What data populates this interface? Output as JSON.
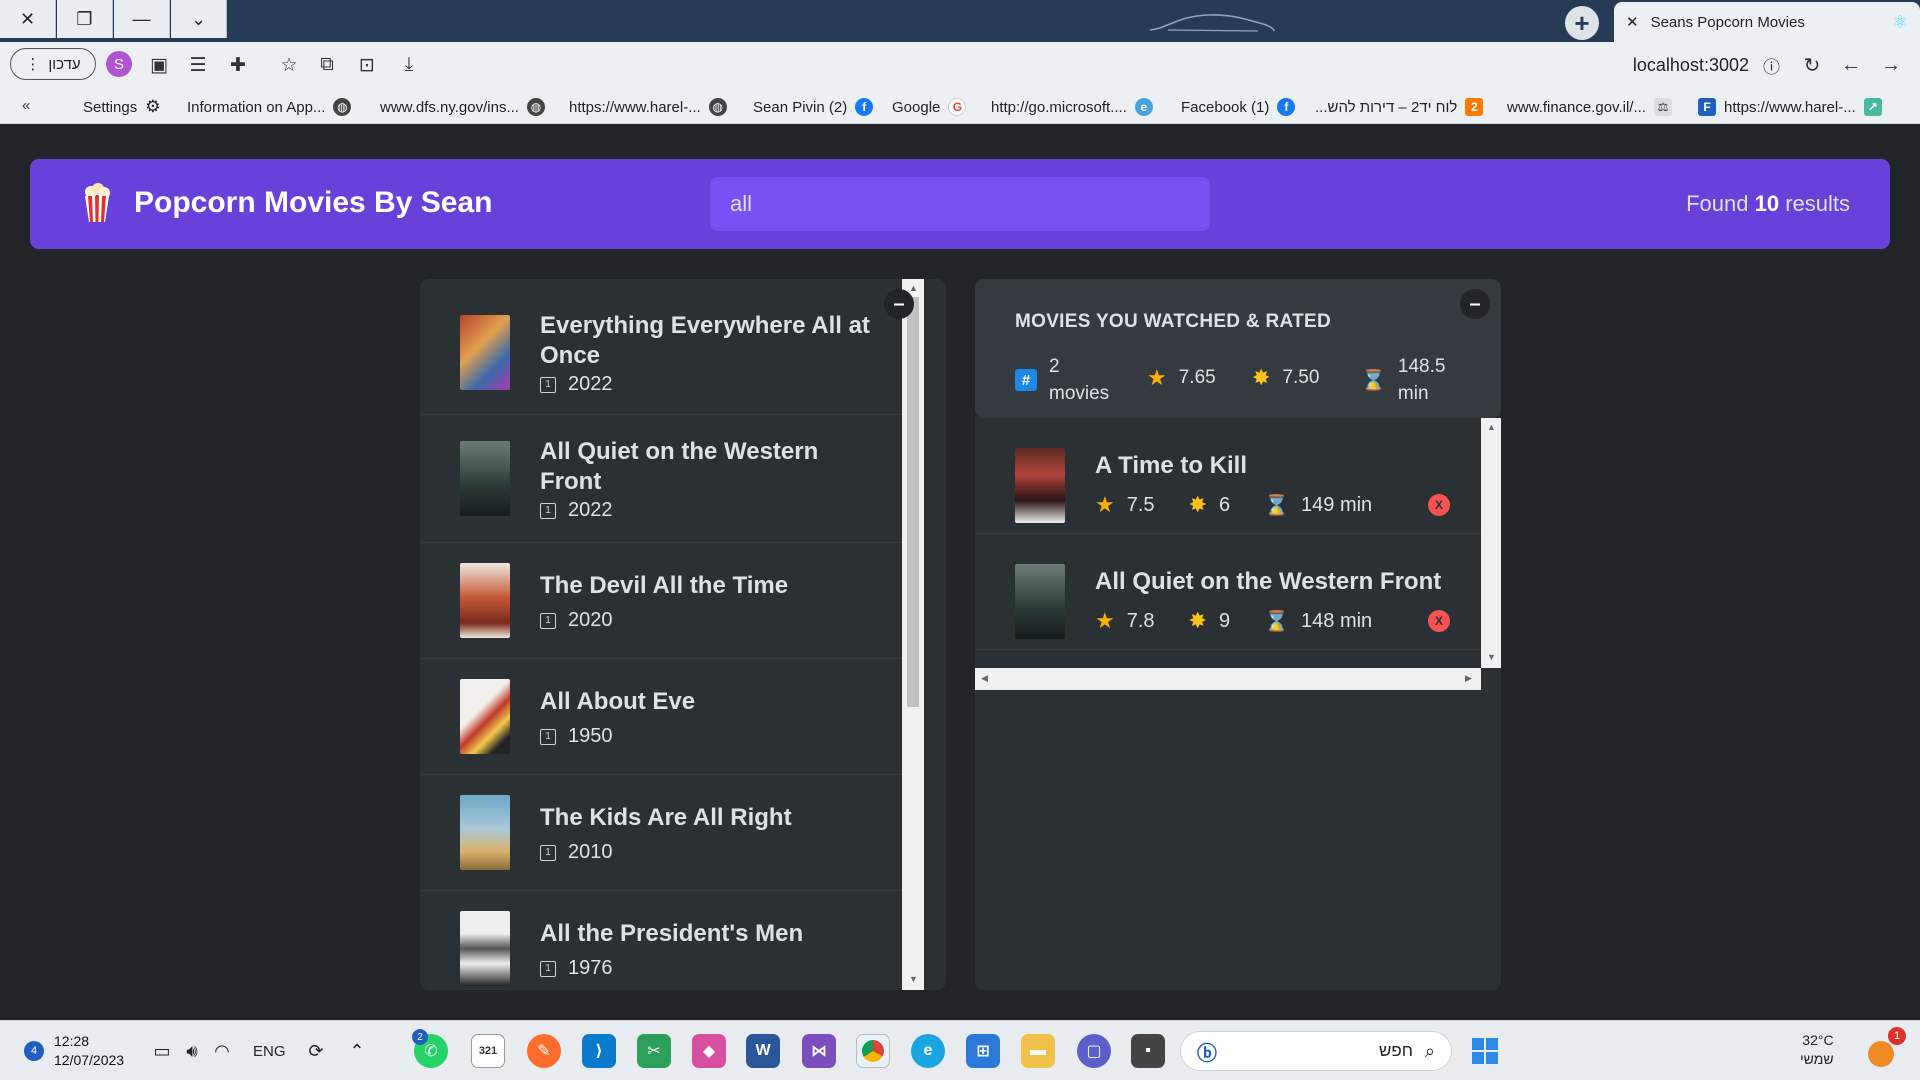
{
  "browser": {
    "tab_title": "Seans Popcorn Movies",
    "workspace_label": "עדכון",
    "profile_initial": "S",
    "address": "localhost:3002",
    "bookmarks": [
      {
        "label": "Settings",
        "icon": "gear-icon"
      },
      {
        "label": "Information on App...",
        "icon": "globe-icon"
      },
      {
        "label": "www.dfs.ny.gov/ins...",
        "icon": "globe-icon"
      },
      {
        "label": "https://www.harel-...",
        "icon": "globe-icon"
      },
      {
        "label": "Sean Pivin (2)",
        "icon": "facebook-icon"
      },
      {
        "label": "Google",
        "icon": "google-icon"
      },
      {
        "label": "http://go.microsoft....",
        "icon": "edge-icon"
      },
      {
        "label": "Facebook (1)",
        "icon": "facebook-icon"
      },
      {
        "label": "לוח יד2 – דירות להש...",
        "icon": "yad2-icon"
      },
      {
        "label": "www.finance.gov.il/...",
        "icon": "gov-icon"
      },
      {
        "label": "https://www.harel-...",
        "icon": "harel-icon"
      }
    ]
  },
  "app": {
    "brand": "Popcorn Movies By Sean",
    "search_value": "all",
    "results_prefix": "Found",
    "results_count": "10",
    "results_suffix": "results",
    "toggle_label": "–",
    "movies": [
      {
        "title": "Everything Everywhere All at Once",
        "year": "2022",
        "poster_colors": [
          "#b8442c",
          "#3d6aa8"
        ]
      },
      {
        "title": "All Quiet on the Western Front",
        "year": "2022",
        "poster_colors": [
          "#4a5a50",
          "#1f2a2a"
        ]
      },
      {
        "title": "The Devil All the Time",
        "year": "2020",
        "poster_colors": [
          "#e8e2d8",
          "#a63a28"
        ]
      },
      {
        "title": "All About Eve",
        "year": "1950",
        "poster_colors": [
          "#f2f0ec",
          "#c0392b"
        ]
      },
      {
        "title": "The Kids Are All Right",
        "year": "2010",
        "poster_colors": [
          "#6fa8c9",
          "#d9b36a"
        ]
      },
      {
        "title": "All the President's Men",
        "year": "1976",
        "poster_colors": [
          "#eeeeee",
          "#333333"
        ]
      }
    ],
    "summary": {
      "heading": "MOVIES YOU WATCHED & RATED",
      "count": "2",
      "count_label": "movies",
      "avg_imdb": "7.65",
      "avg_user": "7.50",
      "avg_runtime": "148.5",
      "runtime_unit": "min"
    },
    "watched": [
      {
        "title": "A Time to Kill",
        "imdb": "7.5",
        "user": "6",
        "runtime": "149 min",
        "poster_colors": [
          "#5a2a22",
          "#1a1a1a"
        ]
      },
      {
        "title": "All Quiet on the Western Front",
        "imdb": "7.8",
        "user": "9",
        "runtime": "148 min",
        "poster_colors": [
          "#4a5a50",
          "#1f2a2a"
        ]
      }
    ],
    "delete_label": "X"
  },
  "taskbar": {
    "time": "12:28",
    "date": "12/07/2023",
    "notification_count": "4",
    "language": "ENG",
    "whatsapp_badge": "2",
    "search_placeholder": "חפש",
    "temperature": "32°C",
    "weather_label": "שמשי",
    "weather_badge": "1"
  },
  "colors": {
    "primary": "#6741d9",
    "primary_light": "#7950f2",
    "background": "#212529",
    "box": "#2b3035",
    "summary": "#343a40",
    "danger": "#fa5252"
  }
}
